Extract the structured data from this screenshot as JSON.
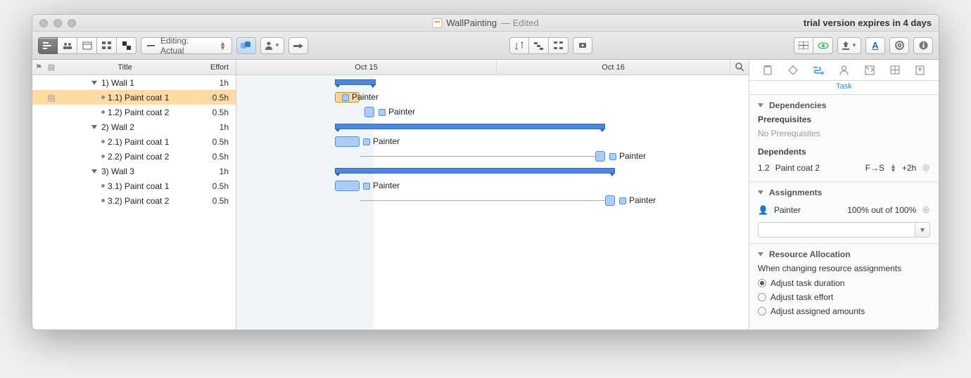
{
  "window": {
    "title": "WallPainting",
    "editedSuffix": " — Edited",
    "trial": "trial version expires in 4 days"
  },
  "toolbar": {
    "editingLabel": "Editing: Actual"
  },
  "outline": {
    "headers": {
      "title": "Title",
      "effort": "Effort"
    },
    "rows": [
      {
        "kind": "group",
        "num": "1)",
        "label": "Wall 1",
        "effort": "1h"
      },
      {
        "kind": "task",
        "num": "1.1)",
        "label": "Paint coat 1",
        "effort": "0.5h",
        "selected": true
      },
      {
        "kind": "task",
        "num": "1.2)",
        "label": "Paint coat 2",
        "effort": "0.5h"
      },
      {
        "kind": "group",
        "num": "2)",
        "label": "Wall 2",
        "effort": "1h"
      },
      {
        "kind": "task",
        "num": "2.1)",
        "label": "Paint coat 1",
        "effort": "0.5h"
      },
      {
        "kind": "task",
        "num": "2.2)",
        "label": "Paint coat 2",
        "effort": "0.5h"
      },
      {
        "kind": "group",
        "num": "3)",
        "label": "Wall 3",
        "effort": "1h"
      },
      {
        "kind": "task",
        "num": "3.1)",
        "label": "Paint coat 1",
        "effort": "0.5h"
      },
      {
        "kind": "task",
        "num": "3.2)",
        "label": "Paint coat 2",
        "effort": "0.5h"
      }
    ]
  },
  "timeline": {
    "cols": [
      "Oct 15",
      "Oct 16"
    ],
    "resource": "Painter"
  },
  "inspector": {
    "tabLabel": "Task",
    "dependencies": {
      "title": "Dependencies",
      "prereqTitle": "Prerequisites",
      "prereqNone": "No Prerequisites",
      "depTitle": "Dependents",
      "dep": {
        "id": "1.2",
        "name": "Paint coat 2",
        "type": "F→S",
        "lag": "+2h"
      }
    },
    "assignments": {
      "title": "Assignments",
      "name": "Painter",
      "units": "100% out of 100%"
    },
    "alloc": {
      "title": "Resource Allocation",
      "lead": "When changing resource assignments",
      "opts": [
        "Adjust task duration",
        "Adjust task effort",
        "Adjust assigned amounts"
      ],
      "selected": 0
    }
  }
}
